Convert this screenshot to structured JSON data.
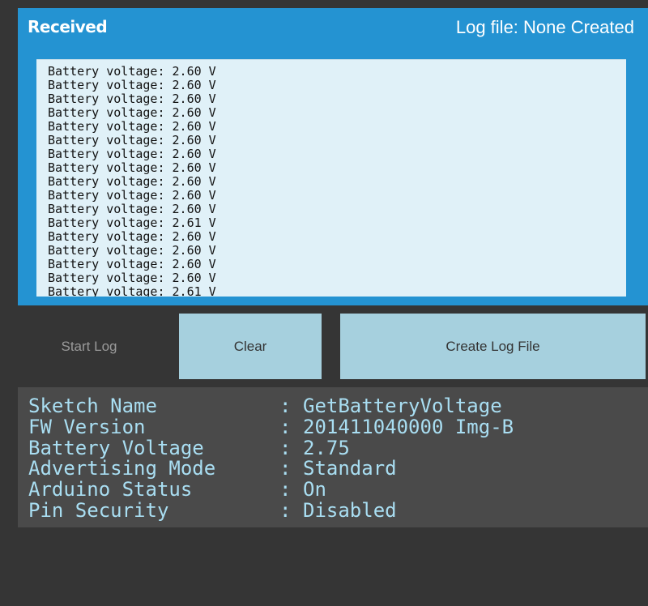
{
  "received_panel": {
    "title": "Received",
    "log_file_status": "Log file: None Created",
    "lines": [
      "Battery voltage: 2.60 V",
      "Battery voltage: 2.60 V",
      "Battery voltage: 2.60 V",
      "Battery voltage: 2.60 V",
      "Battery voltage: 2.60 V",
      "Battery voltage: 2.60 V",
      "Battery voltage: 2.60 V",
      "Battery voltage: 2.60 V",
      "Battery voltage: 2.60 V",
      "Battery voltage: 2.60 V",
      "Battery voltage: 2.60 V",
      "Battery voltage: 2.61 V",
      "Battery voltage: 2.60 V",
      "Battery voltage: 2.60 V",
      "Battery voltage: 2.60 V",
      "Battery voltage: 2.60 V",
      "Battery voltage: 2.61 V"
    ]
  },
  "buttons": {
    "start_log": "Start Log",
    "clear": "Clear",
    "create_log_file": "Create Log File"
  },
  "info": {
    "separator": ":",
    "rows": [
      {
        "key": "Sketch Name",
        "value": "GetBatteryVoltage"
      },
      {
        "key": "FW Version",
        "value": "201411040000 Img-B"
      },
      {
        "key": "Battery Voltage",
        "value": "2.75"
      },
      {
        "key": "Advertising Mode",
        "value": "Standard"
      },
      {
        "key": "Arduino Status",
        "value": "On"
      },
      {
        "key": "Pin Security",
        "value": "Disabled"
      }
    ]
  },
  "colors": {
    "window_background": "#353535",
    "panel_blue": "#2493d2",
    "log_background": "#e0f1f8",
    "button_fill": "#a6d0de",
    "info_background": "#4a4a4a",
    "info_text": "#a9def2"
  }
}
